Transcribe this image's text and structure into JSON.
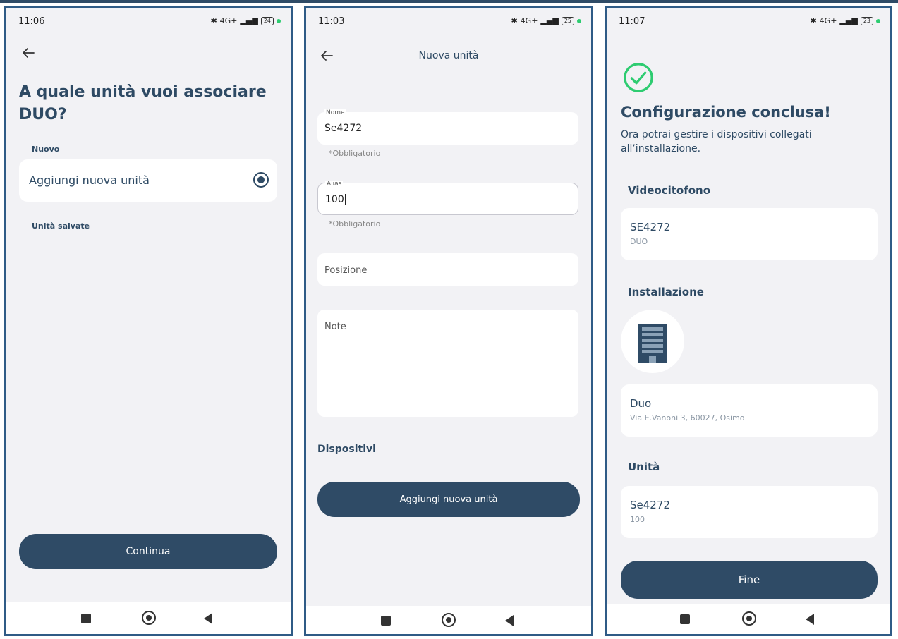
{
  "screen1": {
    "status": {
      "time": "11:06",
      "battery": "24"
    },
    "heading": "A quale unità vuoi associare DUO?",
    "section_new": "Nuovo",
    "option_new": "Aggiungi nuova unità",
    "section_saved": "Unità salvate",
    "continue_button": "Continua"
  },
  "screen2": {
    "status": {
      "time": "11:03",
      "battery": "25"
    },
    "title": "Nuova unità",
    "fields": [
      {
        "label": "Nome",
        "value": "Se4272",
        "helper": "*Obbligatorio"
      },
      {
        "label": "Alias",
        "value": "100",
        "helper": "*Obbligatorio"
      },
      {
        "placeholder": "Posizione"
      },
      {
        "placeholder": "Note"
      }
    ],
    "devices_heading": "Dispositivi",
    "add_button": "Aggiungi nuova unità"
  },
  "screen3": {
    "status": {
      "time": "11:07",
      "battery": "23"
    },
    "heading": "Configurazione conclusa!",
    "subtext": "Ora potrai gestire i dispositivi collegati all’installazione.",
    "videocitofono": {
      "heading": "Videocitofono",
      "title": "SE4272",
      "subtitle": "DUO"
    },
    "installazione": {
      "heading": "Installazione",
      "title": "Duo",
      "subtitle": "Via E.Vanoni 3, 60027, Osimo"
    },
    "unita": {
      "heading": "Unità",
      "title": "Se4272",
      "subtitle": "100"
    },
    "finish_button": "Fine"
  },
  "status_icons": {
    "network": "4G+",
    "bluetooth": "bluetooth-icon",
    "signal": "signal-icon"
  },
  "colors": {
    "primary": "#2f4b66",
    "background": "#f2f2f5",
    "success": "#2ecc71",
    "frame": "#2f5b86"
  }
}
